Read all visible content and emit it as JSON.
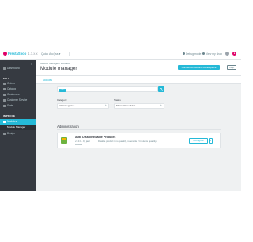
{
  "header": {
    "logo_text": "PrestaShop",
    "version": "1.7.x.x",
    "quick_access": "Quick Access ▾",
    "debug_mode": "Debug mode",
    "view_shop": "View my shop"
  },
  "sidebar": {
    "collapse_label": "◂",
    "dashboard": "Dashboard",
    "sell_section": "SELL",
    "sell_items": [
      "Orders",
      "Catalog",
      "Customers",
      "Customer Service",
      "Stats"
    ],
    "improve_section": "IMPROVE",
    "modules": "Modules",
    "module_manager": "Module Manager",
    "design": "Design"
  },
  "page": {
    "breadcrumb": "Module Manager  /  Modules",
    "title": "Module manager",
    "connect_button": "Connect to Addons marketplace",
    "help_button": "Help",
    "tab_modules": "Modules"
  },
  "filters": {
    "search_tag": "auto",
    "category_label": "Category",
    "category_value": "All Categories",
    "status_label": "Status",
    "status_value": "Show all modules"
  },
  "section": {
    "title": "Administration"
  },
  "module": {
    "name": "Auto Disable Enable Products",
    "version": "v1.0.0 - by jaac",
    "author": "Leaves",
    "description": "Disable product if no quantity, re-enable if it returns quantity.",
    "configure": "Configure",
    "dropdown": "▾"
  },
  "colors": {
    "accent": "#25b9d7",
    "sidebar_bg": "#363a41",
    "content_bg": "#eff1f2",
    "logo_pink": "#df0067"
  }
}
